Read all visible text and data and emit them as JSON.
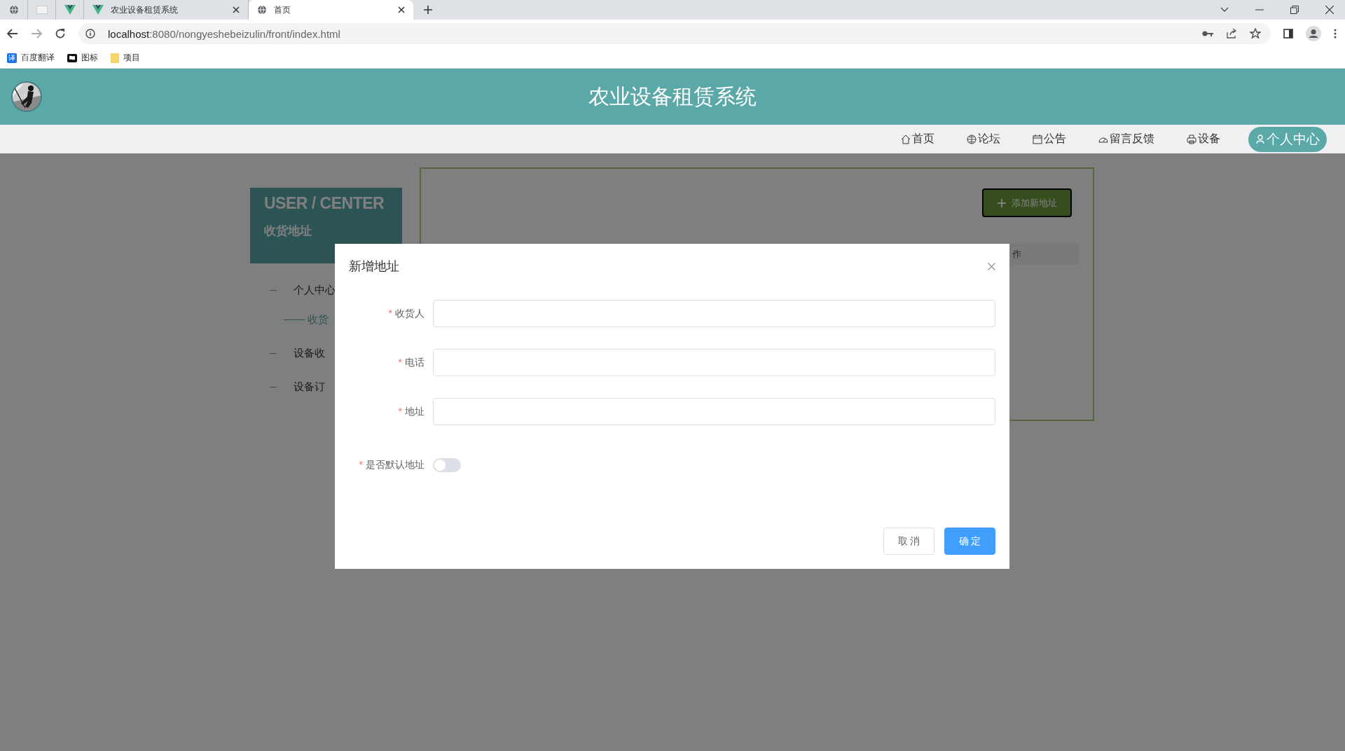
{
  "browser": {
    "tabs": [
      {
        "kind": "globe",
        "selected": false
      },
      {
        "kind": "blank",
        "selected": false
      },
      {
        "kind": "vue",
        "selected": false
      },
      {
        "kind": "vue",
        "title": "农业设备租赁系统",
        "selected": false
      },
      {
        "kind": "globe",
        "title": "首页",
        "selected": true
      }
    ],
    "url_host": "localhost",
    "url_rest": ":8080/nongyeshebeizulin/front/index.html",
    "bookmarks": [
      {
        "kind": "translate",
        "glyph": "译",
        "label": "百度翻译"
      },
      {
        "kind": "flag",
        "label": "图标"
      },
      {
        "kind": "folder",
        "label": "项目"
      }
    ]
  },
  "header": {
    "title": "农业设备租赁系统"
  },
  "nav": [
    {
      "kind": "home",
      "label": "首页",
      "selected": false
    },
    {
      "kind": "globe",
      "label": "论坛",
      "selected": false
    },
    {
      "kind": "calendar",
      "label": "公告",
      "selected": false
    },
    {
      "kind": "gauge",
      "label": "留言反馈",
      "selected": false
    },
    {
      "kind": "printer",
      "label": "设备",
      "selected": false
    },
    {
      "kind": "person",
      "label": "个人中心",
      "selected": true
    }
  ],
  "sidebar": {
    "heading": "USER / CENTER",
    "subheading": "收货地址",
    "items": [
      {
        "label": "个人中心",
        "selected": false,
        "children": [
          {
            "label": "收货",
            "selected": true
          }
        ]
      },
      {
        "label": "设备收",
        "selected": false
      },
      {
        "label": "设备订",
        "selected": false
      }
    ]
  },
  "content": {
    "add_button": "添加新地址",
    "table_header_tail": "作"
  },
  "dialog": {
    "title": "新增地址",
    "fields": [
      {
        "kind": "input",
        "required_mark": "*",
        "label": "收货人"
      },
      {
        "kind": "input",
        "required_mark": "*",
        "label": "电话"
      },
      {
        "kind": "input",
        "required_mark": "*",
        "label": "地址"
      },
      {
        "kind": "switch",
        "required_mark": "*",
        "label": "是否默认地址",
        "on": false
      }
    ],
    "buttons": [
      {
        "label": "取 消",
        "primary": false
      },
      {
        "label": "确 定",
        "primary": true
      }
    ]
  }
}
